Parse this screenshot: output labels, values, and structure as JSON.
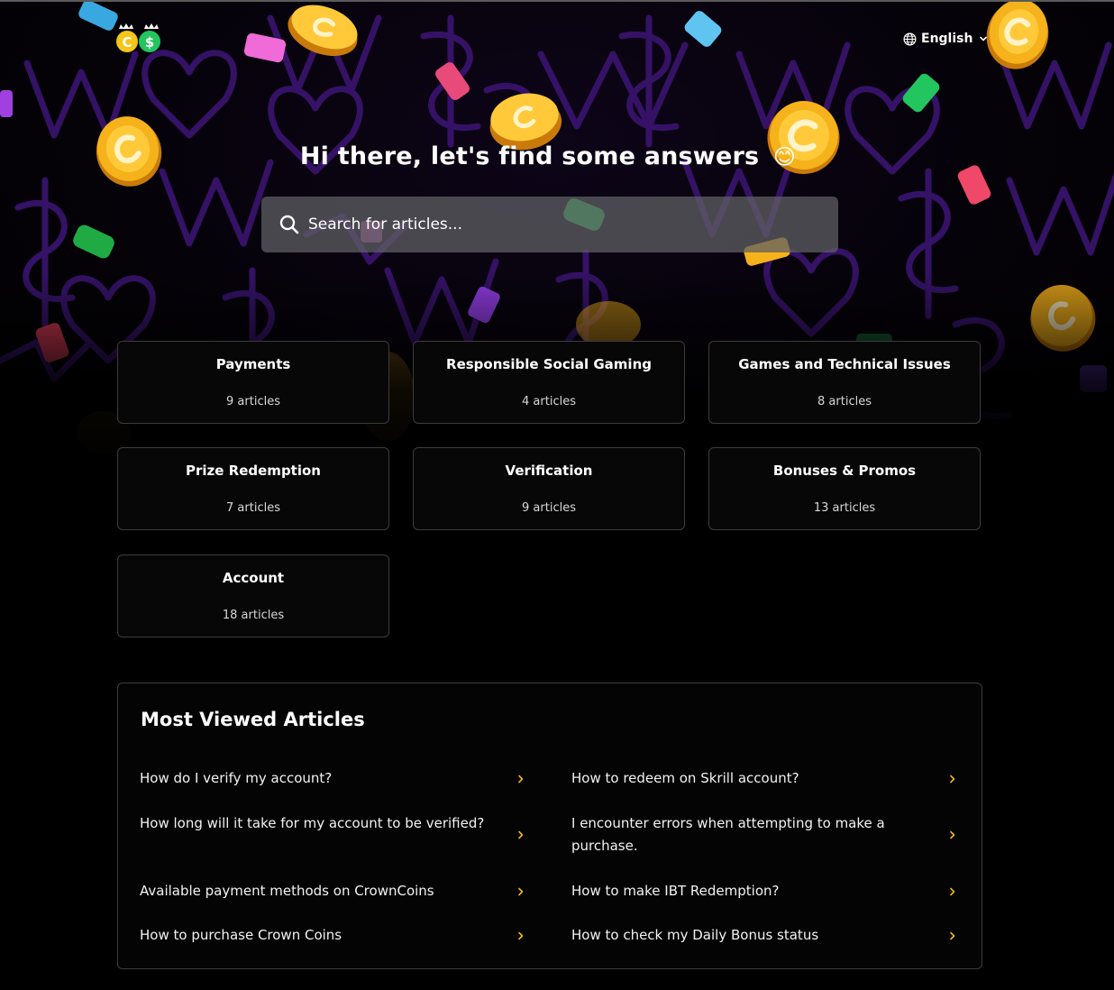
{
  "header": {
    "language": "English"
  },
  "hero": {
    "title": "Hi there, let's find some answers",
    "emoji": "😊"
  },
  "search": {
    "placeholder": "Search for articles..."
  },
  "categories": [
    {
      "title": "Payments",
      "count": "9 articles"
    },
    {
      "title": "Responsible Social Gaming",
      "count": "4 articles"
    },
    {
      "title": "Games and Technical Issues",
      "count": "8 articles"
    },
    {
      "title": "Prize Redemption",
      "count": "7 articles"
    },
    {
      "title": "Verification",
      "count": "9 articles"
    },
    {
      "title": "Bonuses & Promos",
      "count": "13 articles"
    },
    {
      "title": "Account",
      "count": "18 articles"
    }
  ],
  "most_viewed": {
    "title": "Most Viewed Articles",
    "left": [
      "How do I verify my account?",
      "How long will it take for my account to be verified?",
      "Available payment methods on CrownCoins",
      "How to purchase Crown Coins"
    ],
    "right": [
      "How to redeem on Skrill account?",
      "I encounter errors when attempting to make a purchase.",
      "How to make IBT Redemption?",
      "How to check my Daily Bonus status"
    ]
  },
  "colors": {
    "background": "#000000",
    "card_border": "#3c3c3c",
    "accent_gold": "#f5b21a",
    "pattern_purple": "#3a1470"
  }
}
